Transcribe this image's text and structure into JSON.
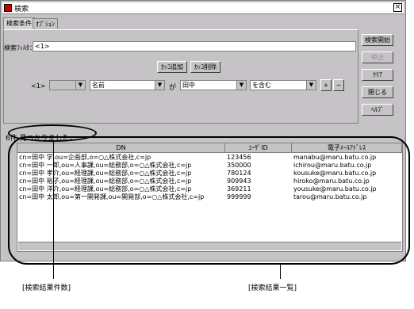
{
  "window": {
    "title": "検索",
    "close": "×"
  },
  "tabs": [
    {
      "label": "検索条件"
    },
    {
      "label": "ｵﾌﾟｼｮﾝ"
    }
  ],
  "filter": {
    "label": "検索ﾌｨﾙﾀ：",
    "value": "<1>"
  },
  "condition_buttons": {
    "add": "ｶｯｺ追加",
    "remove": "ｶｯｺ削除"
  },
  "condition": {
    "tag": "<1>",
    "attribute": "名前",
    "ga": "が",
    "value": "田中",
    "operator": "を含む",
    "plus": "+",
    "minus": "−"
  },
  "side_buttons": {
    "start": "検索開始",
    "stop": "中止",
    "clear": "ｸﾘｱ",
    "close": "閉じる",
    "help": "ﾍﾙﾌﾟ"
  },
  "result_count": "6件 見つかりました。",
  "columns": [
    "DN",
    "ﾕｰｻﾞID",
    "電子ﾒｰﾙｱﾄﾞﾚｽ"
  ],
  "rows": [
    [
      "cn=田中 学,ou=企画部,o=○△株式会社,c=jp",
      "123456",
      "manabu@maru.batu.co.jp"
    ],
    [
      "cn=田中 一郎,ou=人事課,ou=総務部,o=○△株式会社,c=jp",
      "350000",
      "ichirou@maru.batu.co.jp"
    ],
    [
      "cn=田中 孝介,ou=経理課,ou=総務部,o=○△株式会社,c=jp",
      "780124",
      "kousuke@maru.batu.co.jp"
    ],
    [
      "cn=田中 裕子,ou=経理課,ou=総務部,o=○△株式会社,c=jp",
      "909943",
      "hiroko@maru.batu.co.jp"
    ],
    [
      "cn=田中 洋介,ou=経理課,ou=総務部,o=○△株式会社,c=jp",
      "369211",
      "yousuke@maru.batu.co.jp"
    ],
    [
      "cn=田中 太郎,ou=第一開発課,ou=開発部,o=○△株式会社,c=jp",
      "999999",
      "tarou@maru.batu.co.jp"
    ]
  ],
  "annotations": {
    "count": "[検索結果件数]",
    "list": "[検索結果一覧]"
  }
}
